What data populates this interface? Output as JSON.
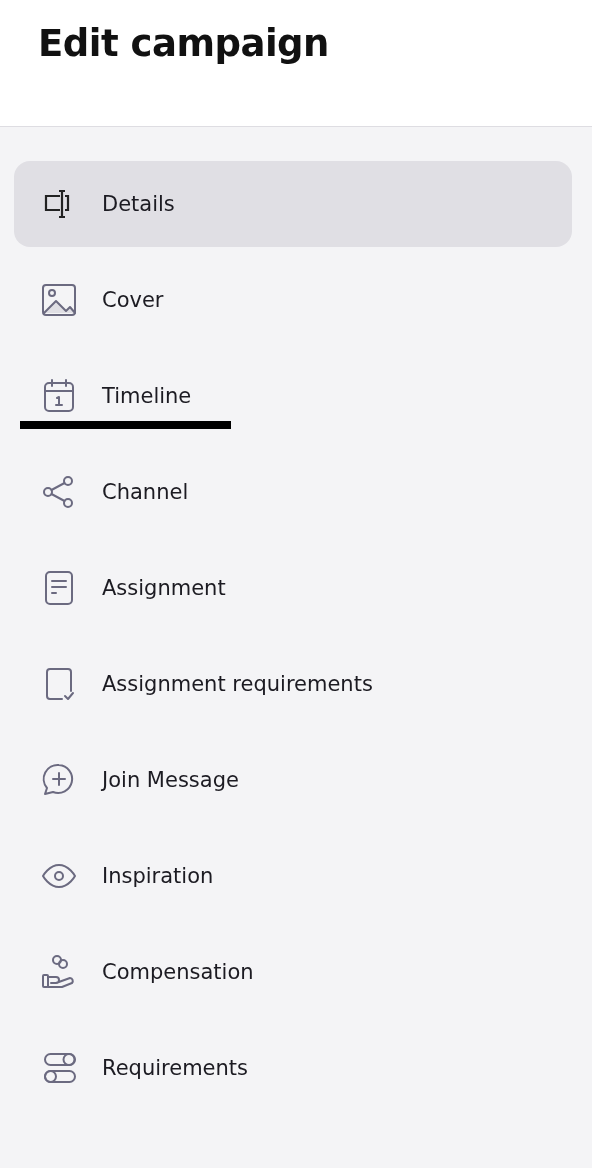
{
  "header": {
    "title": "Edit campaign"
  },
  "menu": [
    {
      "label": "Details",
      "selected": true,
      "underlined": false
    },
    {
      "label": "Cover",
      "selected": false,
      "underlined": false
    },
    {
      "label": "Timeline",
      "selected": false,
      "underlined": true
    },
    {
      "label": "Channel",
      "selected": false,
      "underlined": false
    },
    {
      "label": "Assignment",
      "selected": false,
      "underlined": false
    },
    {
      "label": "Assignment requirements",
      "selected": false,
      "underlined": false
    },
    {
      "label": "Join Message",
      "selected": false,
      "underlined": false
    },
    {
      "label": "Inspiration",
      "selected": false,
      "underlined": false
    },
    {
      "label": "Compensation",
      "selected": false,
      "underlined": false
    },
    {
      "label": "Requirements",
      "selected": false,
      "underlined": false
    }
  ]
}
